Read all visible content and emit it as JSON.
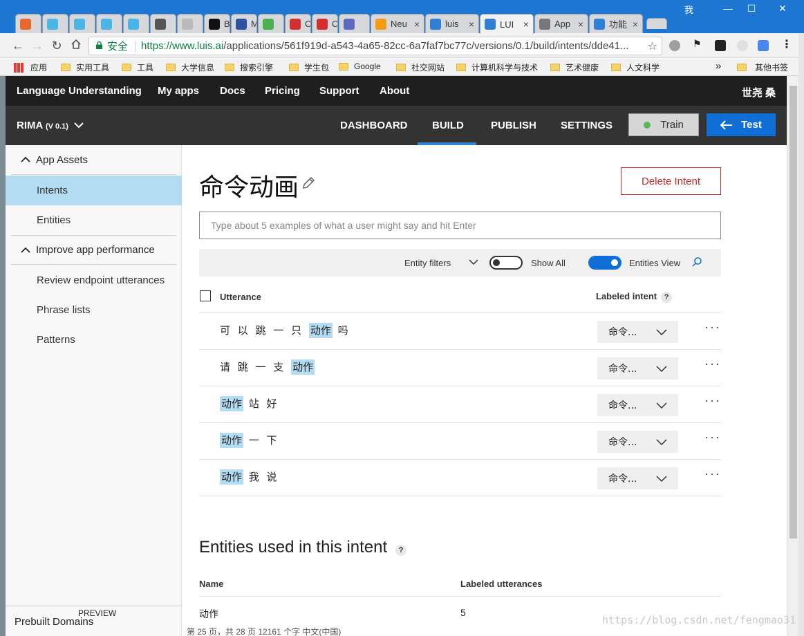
{
  "browser": {
    "tabs": [
      {
        "label": "",
        "color": "#e9692c"
      },
      {
        "label": "",
        "color": "#4bb5e6"
      },
      {
        "label": "",
        "color": "#4bb5e6"
      },
      {
        "label": "",
        "color": "#4bb5e6"
      },
      {
        "label": "",
        "color": "#4bb5e6"
      },
      {
        "label": "",
        "color": "#555555"
      },
      {
        "label": "",
        "color": "#bbbbbb"
      },
      {
        "label": "B",
        "color": "#111111"
      },
      {
        "label": "MAL",
        "color": "#2e51a2"
      },
      {
        "label": "",
        "color": "#4caf50"
      },
      {
        "label": "C",
        "color": "#d32f2f"
      },
      {
        "label": "C",
        "color": "#d32f2f"
      },
      {
        "label": "",
        "color": "#5c6bc0"
      },
      {
        "label": "Neu",
        "color": "#f39c12"
      },
      {
        "label": "luis",
        "color": "#2f7fd6"
      },
      {
        "label": "LUI",
        "color": "#2f7fd6"
      },
      {
        "label": "App",
        "color": "#777777"
      },
      {
        "label": "功能",
        "color": "#2f7fd6"
      }
    ],
    "user_label": "我",
    "secure_label": "安全",
    "url_host": "https://www.luis.ai",
    "url_rest": "/applications/561f919d-a543-4a65-82cc-6a7faf7bc77c/versions/0.1/build/intents/dde41...",
    "bookmarks": [
      "应用",
      "实用工具",
      "工具",
      "大学信息",
      "搜索引擎",
      "学生包",
      "Google",
      "社交网站",
      "计算机科学与技术",
      "艺术健康",
      "人文科学"
    ],
    "bookmarks_more": "»",
    "other_bookmarks": "其他书签"
  },
  "topnav": {
    "brand": "Language Understanding",
    "items": [
      "My apps",
      "Docs",
      "Pricing",
      "Support",
      "About"
    ],
    "user": "世尧 桑"
  },
  "appbar": {
    "app_name": "RIMA",
    "version": "(V 0.1)",
    "tabs": [
      "DASHBOARD",
      "BUILD",
      "PUBLISH",
      "SETTINGS"
    ],
    "train_label": "Train",
    "test_label": "Test"
  },
  "sidebar": {
    "section_assets": "App Assets",
    "intents": "Intents",
    "entities": "Entities",
    "section_improve": "Improve app performance",
    "review": "Review endpoint utterances",
    "phrase_lists": "Phrase lists",
    "patterns": "Patterns",
    "prebuilt": "Prebuilt Domains",
    "preview": "PREVIEW"
  },
  "intent": {
    "title": "命令动画",
    "delete_label": "Delete Intent",
    "input_placeholder": "Type about 5 examples of what a user might say and hit Enter",
    "entity_filters": "Entity filters",
    "show_all": "Show All",
    "entities_view": "Entities View",
    "col_utterance": "Utterance",
    "col_labeled_intent": "Labeled intent",
    "help": "?",
    "entity_label": "动作",
    "intent_short": "命令...",
    "more": "···",
    "utterances": [
      {
        "before": "可 以 跳 一 只 ",
        "entity": "动作",
        "after": " 吗"
      },
      {
        "before": "请 跳 一 支 ",
        "entity": "动作",
        "after": ""
      },
      {
        "before": "",
        "entity": "动作",
        "after": " 站 好"
      },
      {
        "before": "",
        "entity": "动作",
        "after": " 一 下"
      },
      {
        "before": "",
        "entity": "动作",
        "after": " 我 说"
      }
    ]
  },
  "entities_section": {
    "title": "Entities used in this intent",
    "help": "?",
    "col_name": "Name",
    "col_labeled": "Labeled utterances",
    "row_name": "动作",
    "row_count": "5"
  },
  "watermark": "https://blog.csdn.net/fengmao31",
  "status_partial": "第 25 页，共 28 页    12161 个字    中文(中国)"
}
